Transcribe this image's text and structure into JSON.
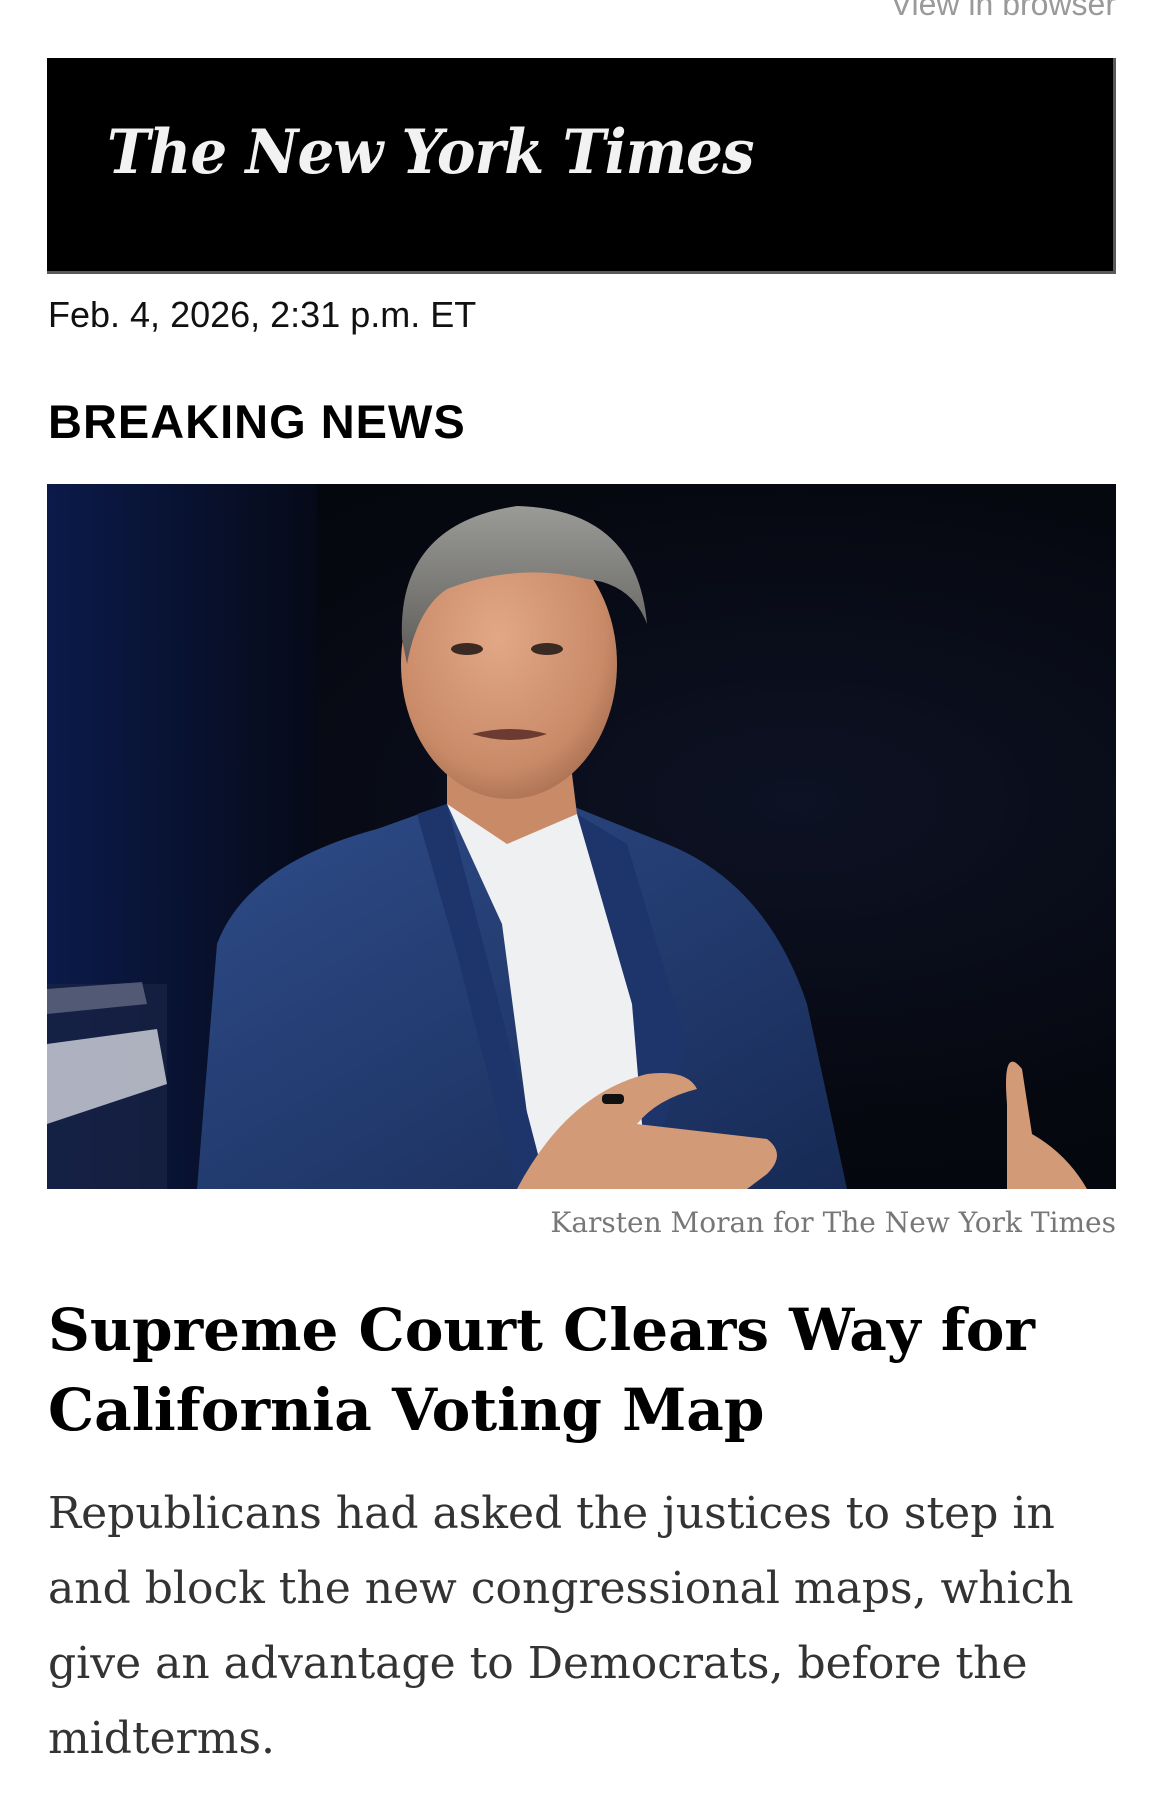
{
  "header": {
    "view_in_browser": "View in browser"
  },
  "masthead": {
    "logo_text": "The New York Times"
  },
  "alert": {
    "timestamp": "Feb. 4, 2026, 2:31 p.m. ET",
    "label": "BREAKING NEWS"
  },
  "photo": {
    "icon": "photo-image",
    "credit": "Karsten Moran for The New York Times"
  },
  "article": {
    "headline": "Supreme Court Clears Way for California Voting Map",
    "summary": "Republicans had asked the justices to step in and block the new congressional maps, which give an advantage to Democrats, before the midterms."
  },
  "colors": {
    "masthead_bg": "#000000",
    "credit_text": "#777777",
    "summary_text": "#333333"
  }
}
